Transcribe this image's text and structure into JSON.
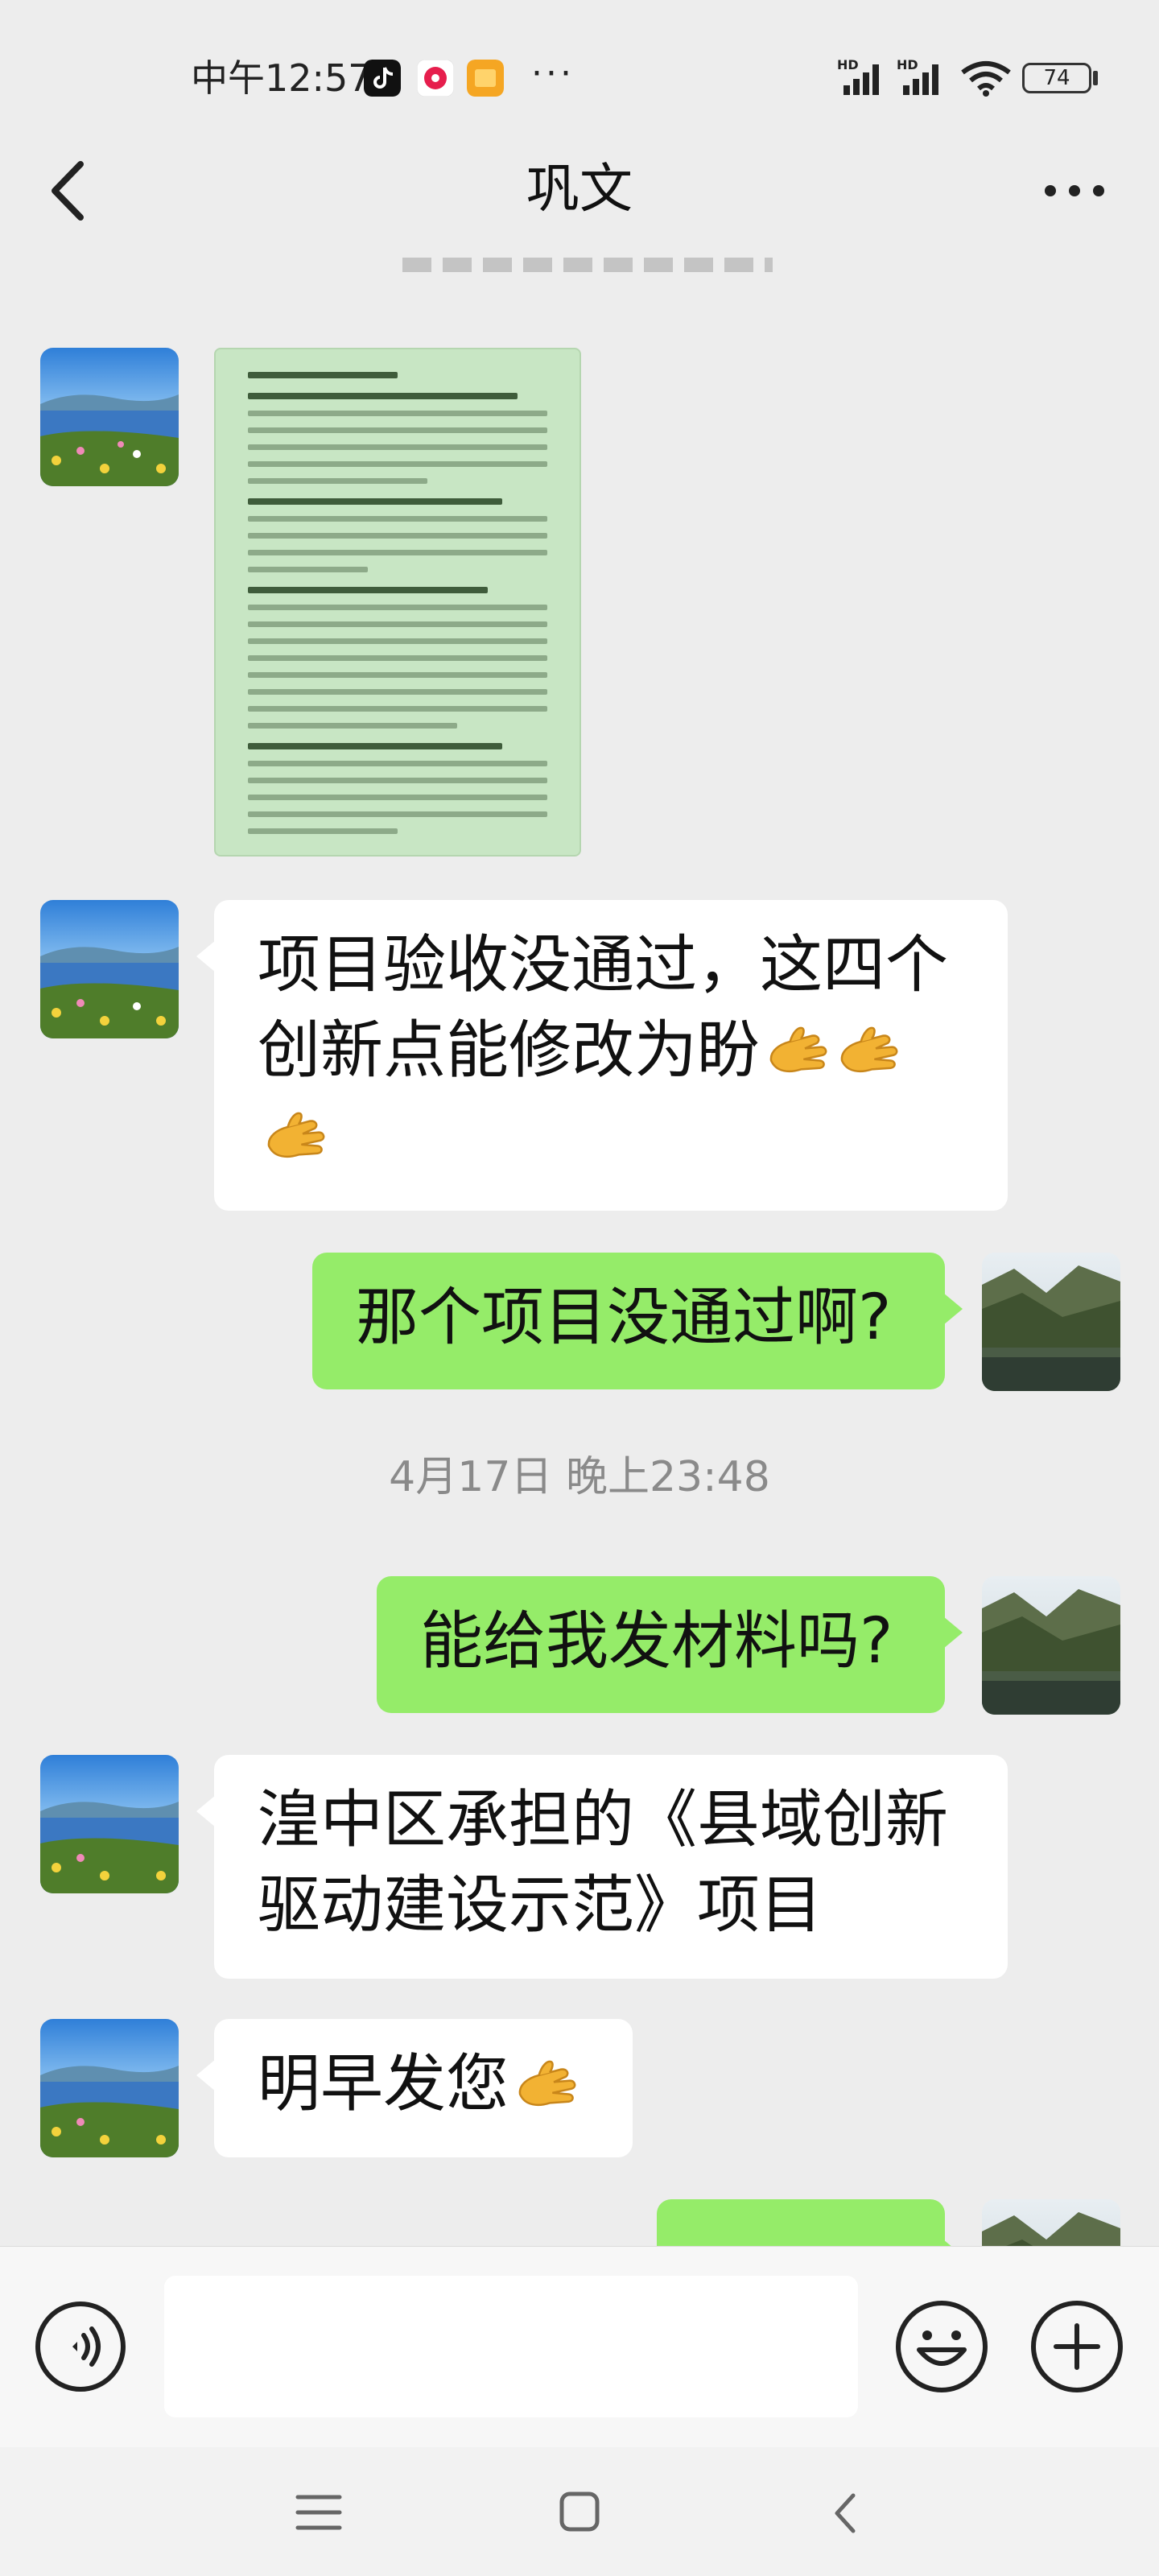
{
  "status_bar": {
    "time": "中午12:57",
    "more_indicator": "···",
    "network_label": "HD",
    "battery_level": "74",
    "icons": [
      "tiktok-icon",
      "record-icon",
      "notes-icon",
      "signal-icon",
      "signal-icon",
      "wifi-icon",
      "battery-icon"
    ]
  },
  "nav": {
    "title": "巩文",
    "back_icon": "chevron-left-icon",
    "more_icon": "more-icon"
  },
  "messages": [
    {
      "from": "other",
      "type": "image",
      "content": "document-photo"
    },
    {
      "from": "other",
      "type": "text",
      "text": "项目验收没通过，这四个创新点能修改为盼",
      "emoji_count": 3
    },
    {
      "from": "me",
      "type": "text",
      "text": "那个项目没通过啊?"
    },
    {
      "from": "system",
      "type": "time",
      "text": "4月17日 晚上23:48"
    },
    {
      "from": "me",
      "type": "text",
      "text": "能给我发材料吗?"
    },
    {
      "from": "other",
      "type": "text",
      "line1": "湟中区承担的《县域创新",
      "line2": "驱动建设示范》项目"
    },
    {
      "from": "other",
      "type": "text",
      "text": "明早发您",
      "emoji_count": 1
    }
  ],
  "input_bar": {
    "voice_icon": "voice-icon",
    "emoji_icon": "emoji-icon",
    "plus_icon": "plus-icon"
  },
  "system_nav": {
    "icons": [
      "menu-icon",
      "home-icon",
      "back-icon"
    ]
  },
  "colors": {
    "background": "#ededed",
    "bubble_out": "#95ec69",
    "bubble_in": "#ffffff",
    "timestamp": "#8a8a8a"
  }
}
